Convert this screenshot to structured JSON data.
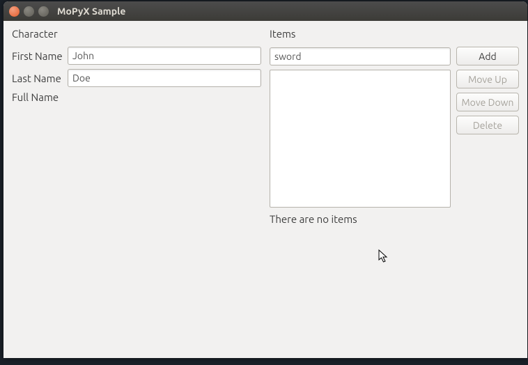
{
  "window": {
    "title": "MoPyX Sample"
  },
  "character": {
    "header": "Character",
    "first_name_label": "First Name",
    "first_name_value": "John",
    "last_name_label": "Last Name",
    "last_name_value": "Doe",
    "full_name_label": "Full Name",
    "full_name_value": ""
  },
  "items": {
    "header": "Items",
    "input_value": "sword",
    "status": "There are no items",
    "buttons": {
      "add": "Add",
      "move_up": "Move Up",
      "move_down": "Move Down",
      "delete": "Delete"
    }
  }
}
